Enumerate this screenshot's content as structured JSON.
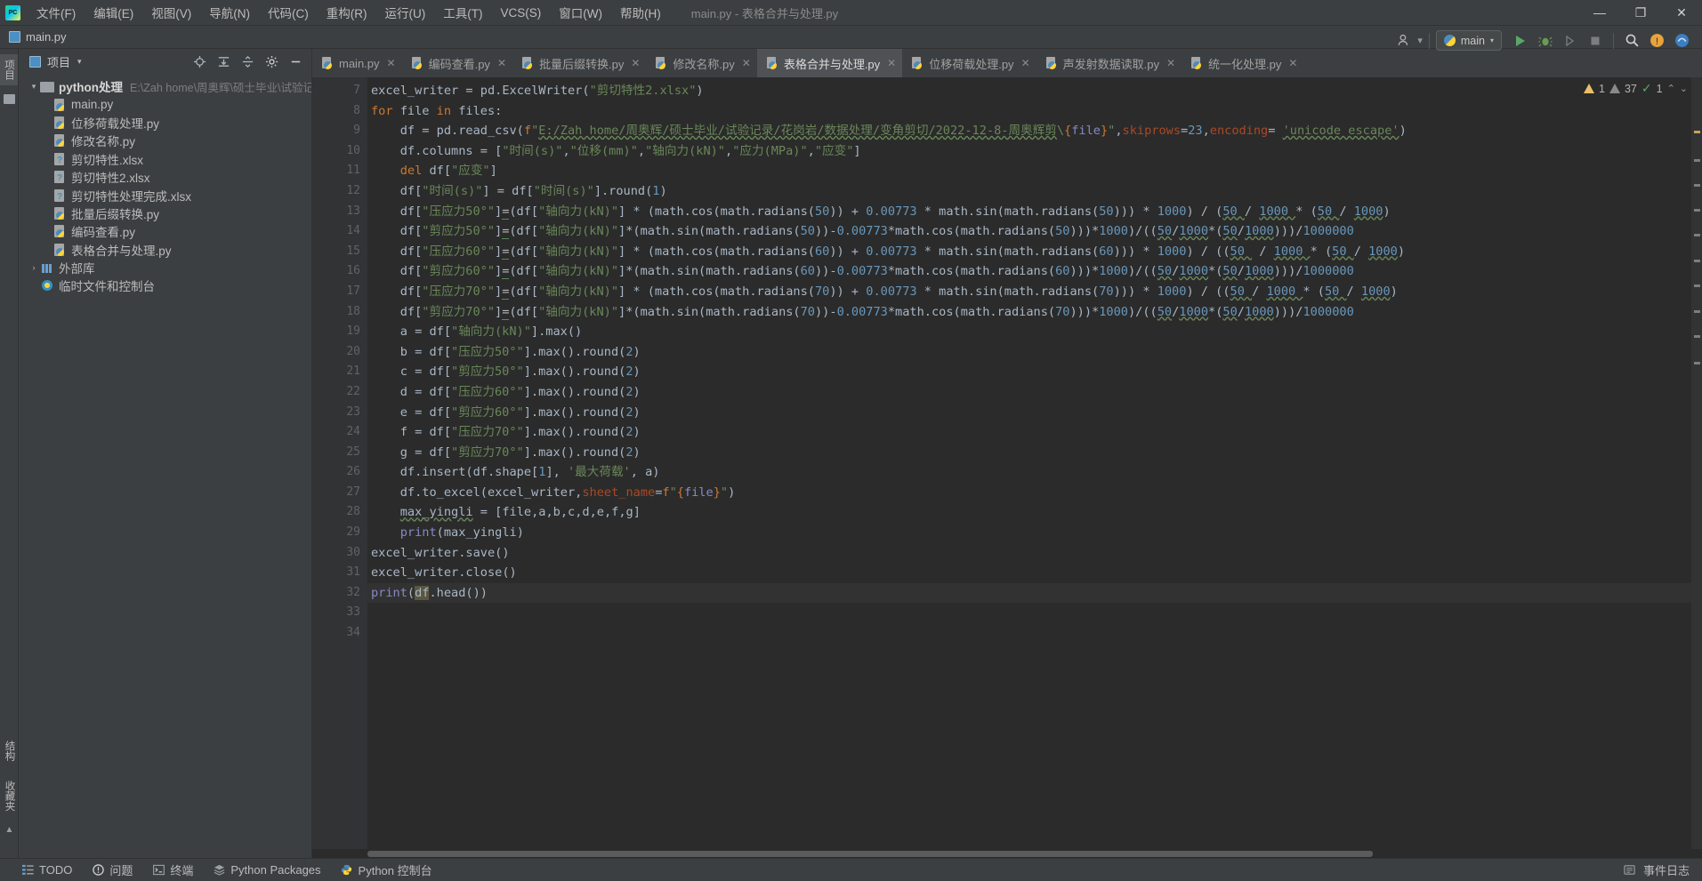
{
  "window": {
    "title": "main.py - 表格合并与处理.py",
    "app_icon": "pycharm-logo"
  },
  "menu": {
    "items": [
      {
        "label": "文件(F)"
      },
      {
        "label": "编辑(E)"
      },
      {
        "label": "视图(V)"
      },
      {
        "label": "导航(N)"
      },
      {
        "label": "代码(C)"
      },
      {
        "label": "重构(R)"
      },
      {
        "label": "运行(U)"
      },
      {
        "label": "工具(T)"
      },
      {
        "label": "VCS(S)"
      },
      {
        "label": "窗口(W)"
      },
      {
        "label": "帮助(H)"
      }
    ]
  },
  "window_controls": {
    "minimize": "—",
    "maximize": "❐",
    "close": "✕"
  },
  "navbar": {
    "crumb": "main.py"
  },
  "toolbar": {
    "run_config_label": "main",
    "run_label": "运行",
    "debug_label": "调试",
    "coverage_label": "覆盖率",
    "stop_label": "停止",
    "search_label": "搜索",
    "caret": "▾"
  },
  "left_strip": {
    "project_tab": "项目",
    "structure_tab": "结构",
    "favorites_tab": "收藏夹"
  },
  "project_panel": {
    "title": "项目",
    "caret": "▾",
    "tools": [
      "locate-icon",
      "expand-all-icon",
      "collapse-all-icon",
      "settings-icon",
      "hide-icon"
    ],
    "tree": [
      {
        "label": "python处理",
        "path": "E:\\Zah home\\周奥辉\\硕士毕业\\试验记录",
        "icon": "folder",
        "arrow": "▾",
        "depth": 0,
        "bold": true
      },
      {
        "label": "main.py",
        "icon": "py",
        "depth": 1
      },
      {
        "label": "位移荷载处理.py",
        "icon": "py",
        "depth": 1
      },
      {
        "label": "修改名称.py",
        "icon": "py",
        "depth": 1
      },
      {
        "label": "剪切特性.xlsx",
        "icon": "xlsx",
        "depth": 1
      },
      {
        "label": "剪切特性2.xlsx",
        "icon": "xlsx",
        "depth": 1
      },
      {
        "label": "剪切特性处理完成.xlsx",
        "icon": "xlsx",
        "depth": 1
      },
      {
        "label": "批量后缀转换.py",
        "icon": "py",
        "depth": 1
      },
      {
        "label": "编码查看.py",
        "icon": "py",
        "depth": 1
      },
      {
        "label": "表格合并与处理.py",
        "icon": "py",
        "depth": 1
      },
      {
        "label": "外部库",
        "icon": "lib",
        "arrow": "›",
        "depth": 0
      },
      {
        "label": "临时文件和控制台",
        "icon": "scratch",
        "depth": 0
      }
    ]
  },
  "editor": {
    "tabs": [
      {
        "label": "main.py",
        "active": false
      },
      {
        "label": "编码查看.py",
        "active": false
      },
      {
        "label": "批量后缀转换.py",
        "active": false
      },
      {
        "label": "修改名称.py",
        "active": false
      },
      {
        "label": "表格合并与处理.py",
        "active": true
      },
      {
        "label": "位移荷载处理.py",
        "active": false
      },
      {
        "label": "声发射数据读取.py",
        "active": false
      },
      {
        "label": "统一化处理.py",
        "active": false
      }
    ],
    "close_glyph": "✕",
    "inspections": {
      "warning_count": "1",
      "weak_warning_count": "37",
      "ok_count": "1",
      "up_glyph": "⌃",
      "down_glyph": "⌄"
    },
    "first_line_number": 7,
    "lines": [
      {
        "n": 7,
        "text": "excel_writer = pd.ExcelWriter(\"剪切特性2.xlsx\")"
      },
      {
        "n": 8,
        "text": "for file in files:"
      },
      {
        "n": 9,
        "text": "    df = pd.read_csv(f\"E:/Zah home/周奥辉/硕士毕业/试验记录/花岗岩/数据处理/变角剪切/2022-12-8-周奥辉剪\\{file}\",skiprows=23,encoding= 'unicode_escape')"
      },
      {
        "n": 10,
        "text": "    df.columns = [\"时间(s)\",\"位移(mm)\",\"轴向力(kN)\",\"应力(MPa)\",\"应变\"]"
      },
      {
        "n": 11,
        "text": "    del df[\"应变\"]"
      },
      {
        "n": 12,
        "text": "    df[\"时间(s)\"] = df[\"时间(s)\"].round(1)"
      },
      {
        "n": 13,
        "text": "    df[\"压应力50°\"]=(df[\"轴向力(kN)\"] * (math.cos(math.radians(50)) + 0.00773 * math.sin(math.radians(50))) * 1000) / (50 / 1000 * (50 / 1000))"
      },
      {
        "n": 14,
        "text": "    df[\"剪应力50°\"]=(df[\"轴向力(kN)\"]*(math.sin(math.radians(50))-0.00773*math.cos(math.radians(50)))*1000)/((50/1000*(50/1000)))/1000000"
      },
      {
        "n": 15,
        "text": "    df[\"压应力60°\"]=(df[\"轴向力(kN)\"] * (math.cos(math.radians(60)) + 0.00773 * math.sin(math.radians(60))) * 1000) / ((50 / 1000 * (50 / 1000))"
      },
      {
        "n": 16,
        "text": "    df[\"剪应力60°\"]=(df[\"轴向力(kN)\"]*(math.sin(math.radians(60))-0.00773*math.cos(math.radians(60)))*1000)/((50/1000*(50/1000)))/1000000"
      },
      {
        "n": 17,
        "text": "    df[\"压应力70°\"]=(df[\"轴向力(kN)\"] * (math.cos(math.radians(70)) + 0.00773 * math.sin(math.radians(70))) * 1000) / ((50 / 1000 * (50 / 1000))"
      },
      {
        "n": 18,
        "text": "    df[\"剪应力70°\"]=(df[\"轴向力(kN)\"]*(math.sin(math.radians(70))-0.00773*math.cos(math.radians(70)))*1000)/((50/1000*(50/1000)))/1000000"
      },
      {
        "n": 19,
        "text": "    a = df[\"轴向力(kN)\"].max()"
      },
      {
        "n": 20,
        "text": "    b = df[\"压应力50°\"].max().round(2)"
      },
      {
        "n": 21,
        "text": "    c = df[\"剪应力50°\"].max().round(2)"
      },
      {
        "n": 22,
        "text": "    d = df[\"压应力60°\"].max().round(2)"
      },
      {
        "n": 23,
        "text": "    e = df[\"剪应力60°\"].max().round(2)"
      },
      {
        "n": 24,
        "text": "    f = df[\"压应力70°\"].max().round(2)"
      },
      {
        "n": 25,
        "text": "    g = df[\"剪应力70°\"].max().round(2)"
      },
      {
        "n": 26,
        "text": "    df.insert(df.shape[1], '最大荷载', a)"
      },
      {
        "n": 27,
        "text": "    df.to_excel(excel_writer,sheet_name=f\"{file}\")"
      },
      {
        "n": 28,
        "text": "    max_yingli = [file,a,b,c,d,e,f,g]"
      },
      {
        "n": 29,
        "text": "    print(max_yingli)"
      },
      {
        "n": 30,
        "text": "excel_writer.save()"
      },
      {
        "n": 31,
        "text": "excel_writer.close()"
      },
      {
        "n": 32,
        "text": "print(df.head())"
      },
      {
        "n": 33,
        "text": ""
      },
      {
        "n": 34,
        "text": ""
      }
    ]
  },
  "status_bar": {
    "items": [
      {
        "label": "TODO",
        "icon": "todo-icon"
      },
      {
        "label": "问题",
        "icon": "problems-icon"
      },
      {
        "label": "终端",
        "icon": "terminal-icon"
      },
      {
        "label": "Python Packages",
        "icon": "packages-icon"
      },
      {
        "label": "Python 控制台",
        "icon": "python-console-icon"
      }
    ],
    "right_label": "事件日志",
    "right_icon": "event-log-icon"
  },
  "colors": {
    "accent_blue": "#4a90c4",
    "warning_yellow": "#e8bf6a",
    "ok_green": "#59a869",
    "bg_editor": "#2b2b2b",
    "bg_chrome": "#3c3f41"
  }
}
